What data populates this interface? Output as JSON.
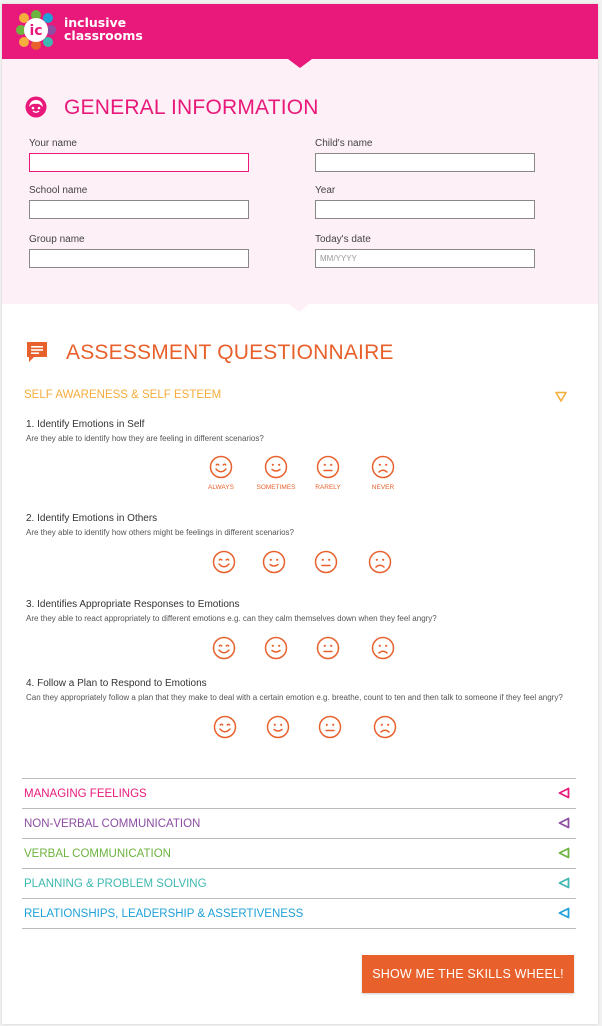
{
  "header": {
    "logo_line1": "inclusive",
    "logo_line2": "classrooms",
    "brand_color": "#e8197a"
  },
  "general": {
    "title": "GENERAL INFORMATION",
    "fields": {
      "your_name": {
        "label": "Your name",
        "value": "",
        "placeholder": ""
      },
      "child_name": {
        "label": "Child's name",
        "value": "",
        "placeholder": ""
      },
      "school_name": {
        "label": "School name",
        "value": "",
        "placeholder": ""
      },
      "year": {
        "label": "Year",
        "value": "",
        "placeholder": ""
      },
      "group_name": {
        "label": "Group name",
        "value": "",
        "placeholder": ""
      },
      "todays_date": {
        "label": "Today's date",
        "value": "",
        "placeholder": "MM/YYYY"
      }
    }
  },
  "assessment": {
    "title": "ASSESSMENT QUESTIONNAIRE",
    "accent_color": "#e8612c",
    "open_category": {
      "label": "SELF AWARENESS & SELF ESTEEM",
      "color": "#f5ad3c",
      "rating_labels": [
        "ALWAYS",
        "SOMETIMES",
        "RARELY",
        "NEVER"
      ],
      "questions": [
        {
          "title": "1. Identify Emotions in Self",
          "desc": "Are they able to identify how they are feeling in different scenarios?"
        },
        {
          "title": "2. Identify Emotions in Others",
          "desc": "Are they able to identify how others might be feelings in different scenarios?"
        },
        {
          "title": "3. Identifies Appropriate Responses to Emotions",
          "desc": "Are they able to react appropriately to different emotions e.g. can they calm themselves down when they feel angry?"
        },
        {
          "title": "4. Follow a Plan to Respond to Emotions",
          "desc": "Can they appropriately follow a plan that they make to deal with a certain emotion e.g. breathe, count to ten and then talk to someone if they feel angry?"
        }
      ]
    },
    "categories": [
      {
        "label": "MANAGING FEELINGS",
        "color": "#e8197a"
      },
      {
        "label": "NON-VERBAL COMMUNICATION",
        "color": "#8d4ea3"
      },
      {
        "label": "VERBAL COMMUNICATION",
        "color": "#6db33f"
      },
      {
        "label": "PLANNING & PROBLEM SOLVING",
        "color": "#3eb8b0"
      },
      {
        "label": "RELATIONSHIPS, LEADERSHIP & ASSERTIVENESS",
        "color": "#1fa0d8"
      }
    ]
  },
  "cta": {
    "label": "SHOW ME THE SKILLS WHEEL!"
  }
}
